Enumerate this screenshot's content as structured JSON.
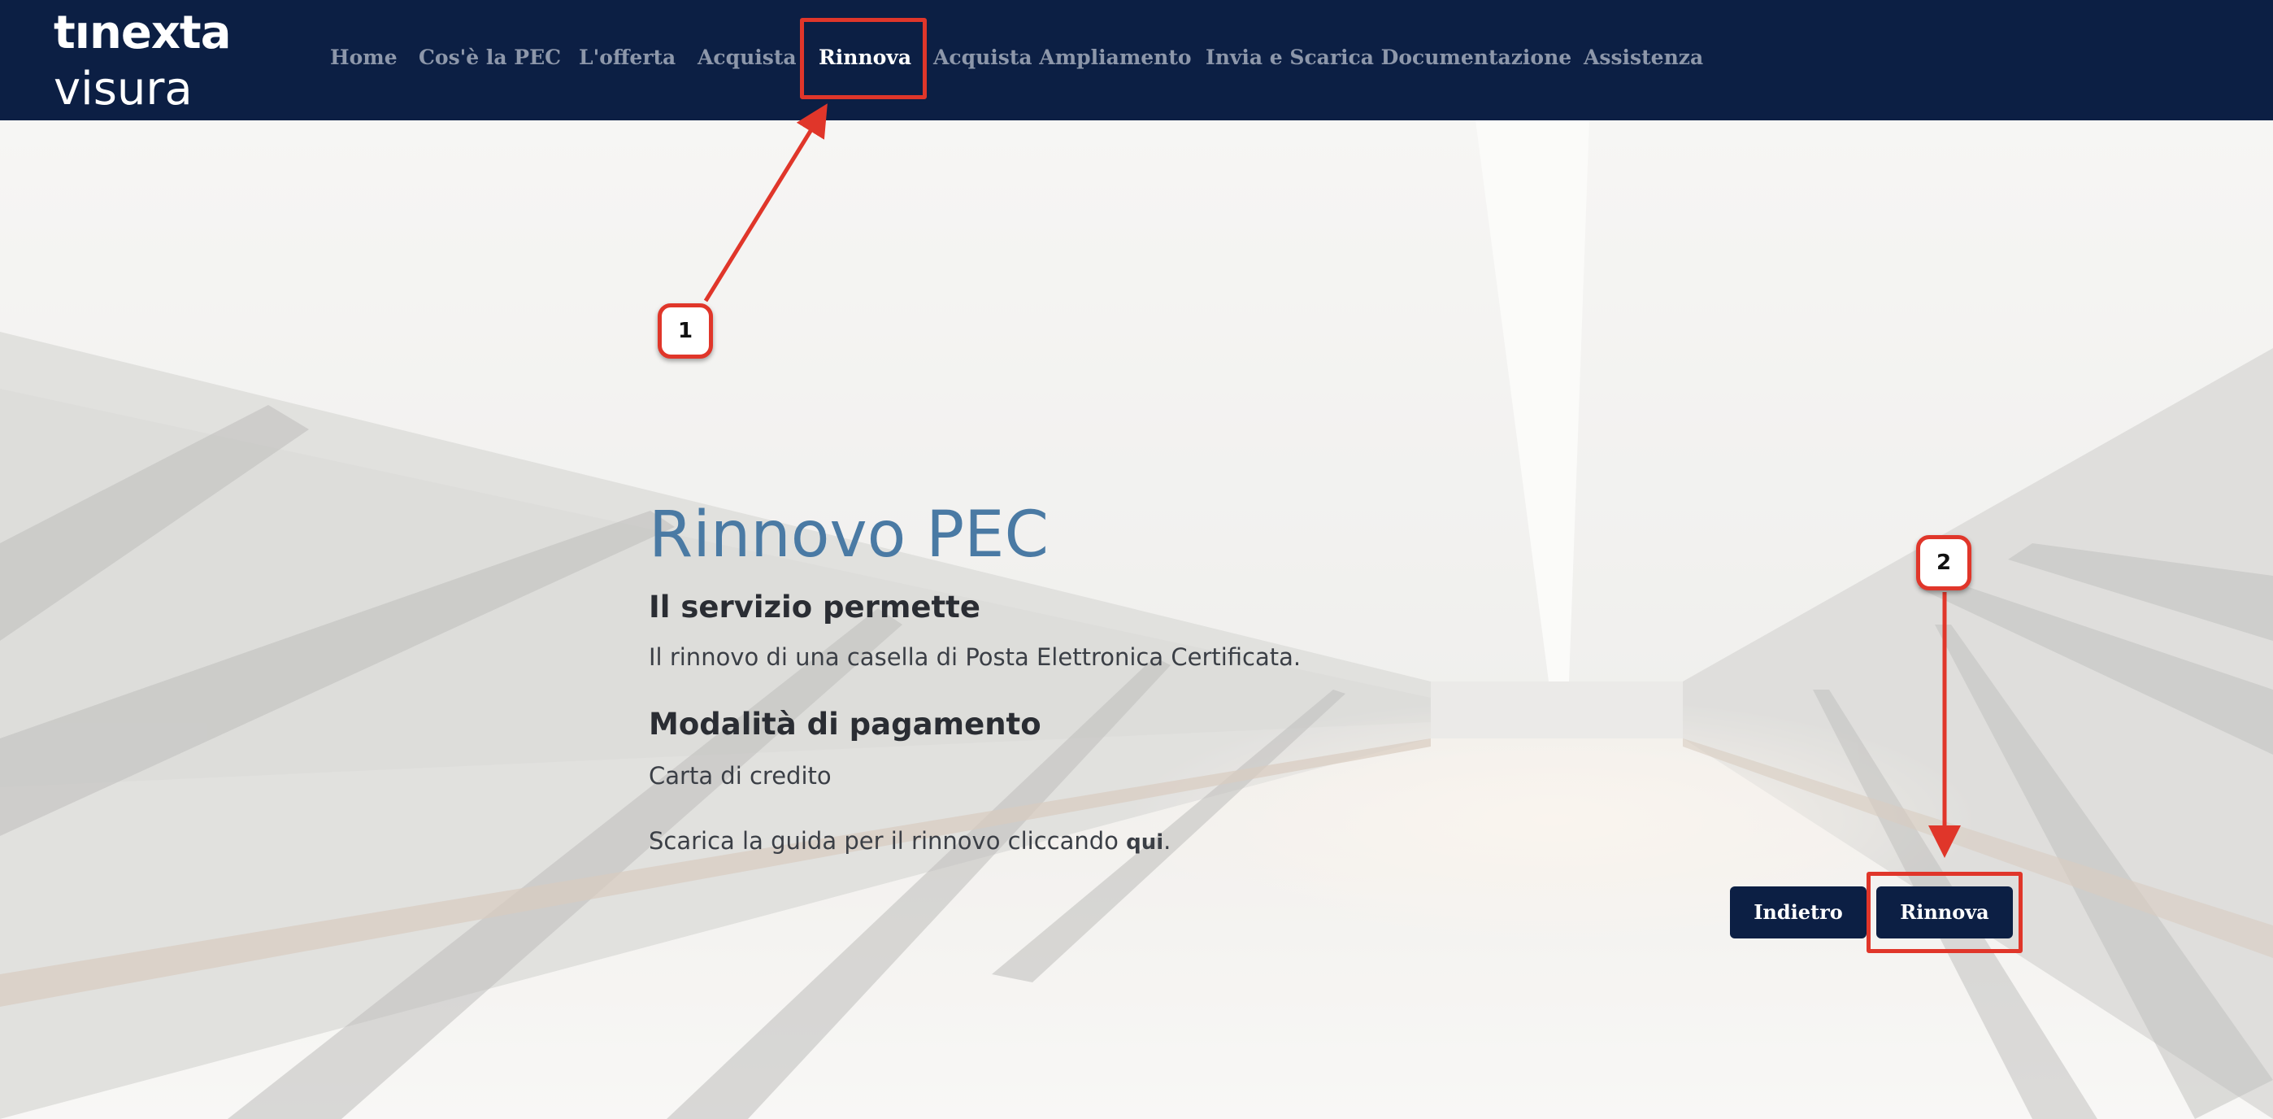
{
  "header": {
    "logo_brand": "tınexta",
    "logo_sub": "visura",
    "nav": [
      {
        "label": "Home",
        "active": false
      },
      {
        "label": "Cos'è la PEC",
        "active": false
      },
      {
        "label": "L'offerta",
        "active": false
      },
      {
        "label": "Acquista",
        "active": false
      },
      {
        "label": "Rinnova",
        "active": true
      },
      {
        "label": "Acquista Ampliamento",
        "active": false
      },
      {
        "label": "Invia e Scarica Documentazione",
        "active": false
      },
      {
        "label": "Assistenza",
        "active": false
      }
    ]
  },
  "content": {
    "title": "Rinnovo PEC",
    "section1_heading": "Il servizio permette",
    "section1_text": "Il rinnovo di una casella di Posta Elettronica Certificata.",
    "section2_heading": "Modalità di pagamento",
    "section2_text": "Carta di credito",
    "guide_text": "Scarica la guida per il rinnovo cliccando ",
    "guide_link": "qui",
    "guide_end": "."
  },
  "buttons": {
    "back": "Indietro",
    "renew": "Rinnova"
  },
  "annotations": {
    "step1": "1",
    "step2": "2"
  },
  "colors": {
    "header_bg": "#0c1f44",
    "title": "#4a7aa4",
    "annotation_red": "#e0362a",
    "button_bg": "#0c1f44"
  }
}
